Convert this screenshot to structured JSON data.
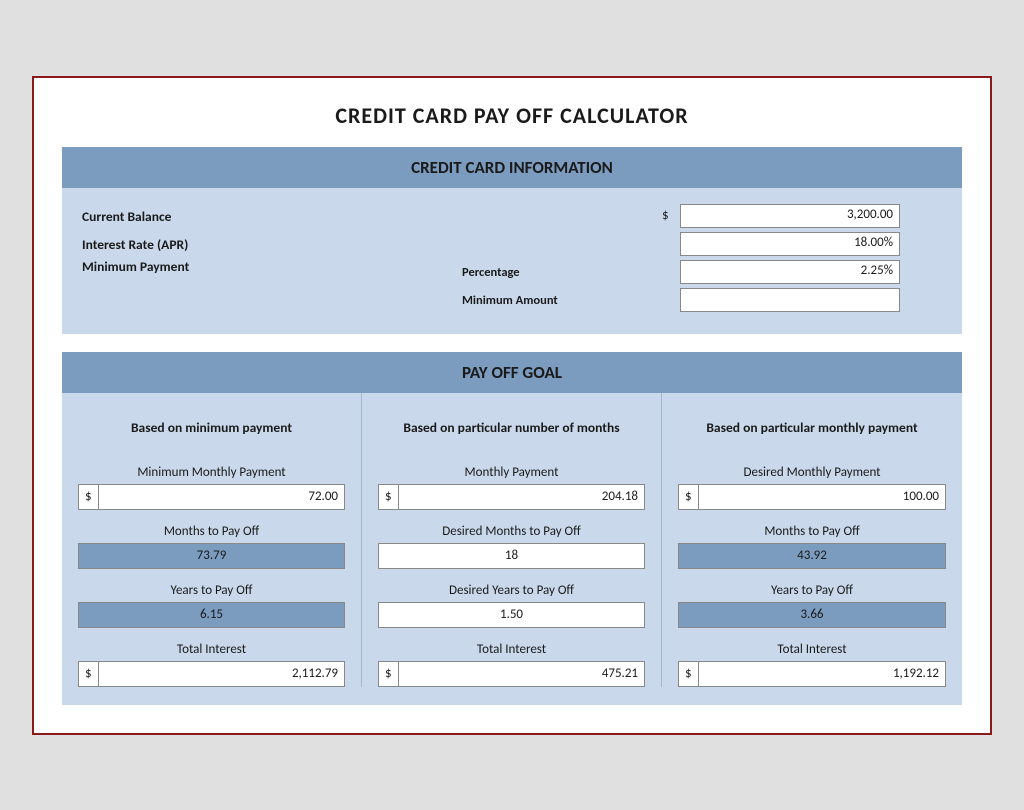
{
  "title": "CREDIT CARD PAY OFF CALCULATOR",
  "credit_card_section": {
    "header": "CREDIT CARD INFORMATION",
    "fields": [
      {
        "label": "Current Balance",
        "sublabel": null,
        "dollar": "$",
        "value": "3,200.00"
      },
      {
        "label": "Interest Rate (APR)",
        "sublabel": null,
        "dollar": null,
        "value": "18.00%"
      },
      {
        "label": "Minimum Payment",
        "sublabel": "Percentage",
        "dollar": null,
        "value": "2.25%"
      },
      {
        "label": "",
        "sublabel": "Minimum Amount",
        "dollar": null,
        "value": ""
      }
    ]
  },
  "payoff_section": {
    "header": "PAY OFF GOAL",
    "columns": [
      {
        "header": "Based on minimum payment",
        "field1_label": "Minimum Monthly Payment",
        "field1_dollar": "$",
        "field1_value": "72.00",
        "field2_label": "Months to Pay Off",
        "field2_value": "73.79",
        "field2_shaded": true,
        "field3_label": "Years to Pay Off",
        "field3_value": "6.15",
        "field3_shaded": true,
        "field4_label": "Total Interest",
        "field4_dollar": "$",
        "field4_value": "2,112.79"
      },
      {
        "header": "Based on particular number of months",
        "field1_label": "Monthly Payment",
        "field1_dollar": "$",
        "field1_value": "204.18",
        "field2_label": "Desired Months to Pay Off",
        "field2_value": "18",
        "field2_shaded": false,
        "field3_label": "Desired Years to Pay Off",
        "field3_value": "1.50",
        "field3_shaded": false,
        "field4_label": "Total Interest",
        "field4_dollar": "$",
        "field4_value": "475.21"
      },
      {
        "header": "Based on particular monthly payment",
        "field1_label": "Desired Monthly Payment",
        "field1_dollar": "$",
        "field1_value": "100.00",
        "field2_label": "Months to Pay Off",
        "field2_value": "43.92",
        "field2_shaded": true,
        "field3_label": "Years to Pay Off",
        "field3_value": "3.66",
        "field3_shaded": true,
        "field4_label": "Total Interest",
        "field4_dollar": "$",
        "field4_value": "1,192.12"
      }
    ]
  }
}
